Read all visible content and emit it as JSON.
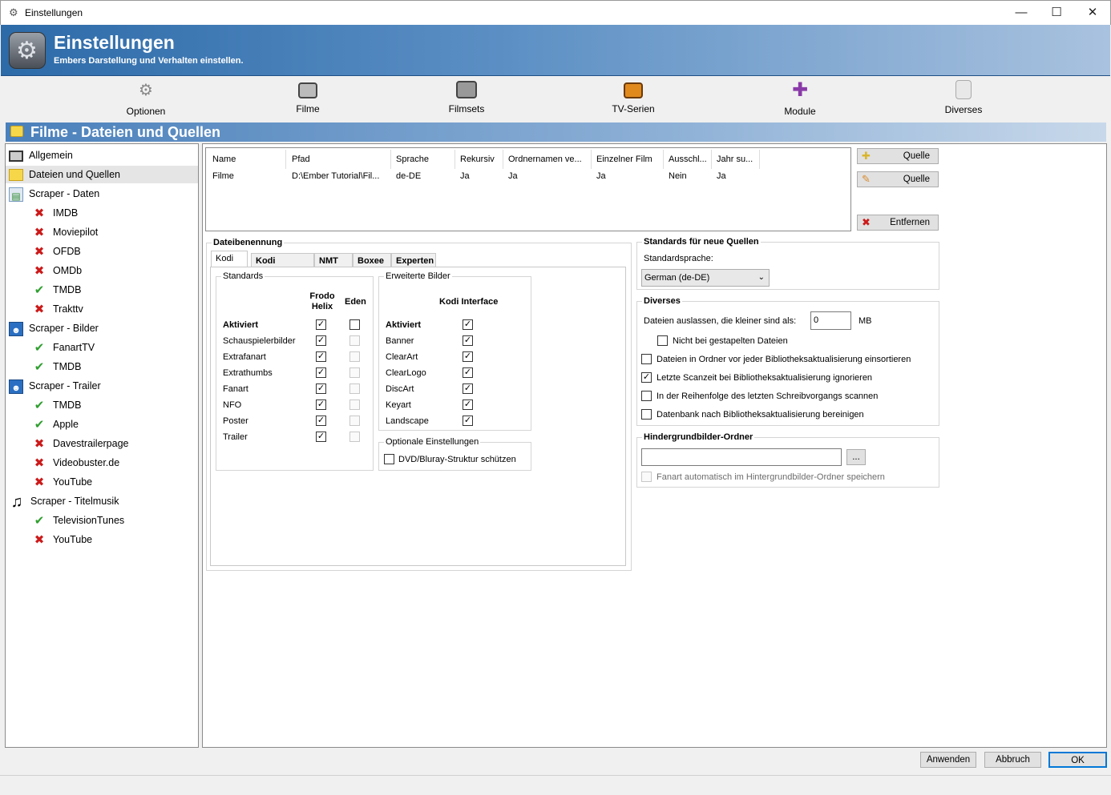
{
  "window": {
    "title": "Einstellungen",
    "minimize": "—",
    "maximize": "☐",
    "close": "✕"
  },
  "banner": {
    "title": "Einstellungen",
    "subtitle": "Embers Darstellung und Verhalten einstellen."
  },
  "toolbar": [
    {
      "label": "Optionen",
      "icon": "gear-icon"
    },
    {
      "label": "Filme",
      "icon": "film-icon"
    },
    {
      "label": "Filmsets",
      "icon": "filmsets-icon"
    },
    {
      "label": "TV-Serien",
      "icon": "tv-icon"
    },
    {
      "label": "Module",
      "icon": "puzzle-icon"
    },
    {
      "label": "Diverses",
      "icon": "document-icon"
    }
  ],
  "section_title": "Filme - Dateien und Quellen",
  "tree": [
    {
      "label": "Allgemein",
      "icon": "film-icon",
      "level": 0
    },
    {
      "label": "Dateien und Quellen",
      "icon": "folder-icon",
      "level": 0,
      "selected": true
    },
    {
      "label": "Scraper - Daten",
      "icon": "scraper-data-icon",
      "level": 0
    },
    {
      "label": "IMDB",
      "icon": "x-icon",
      "level": 1
    },
    {
      "label": "Moviepilot",
      "icon": "x-icon",
      "level": 1
    },
    {
      "label": "OFDB",
      "icon": "x-icon",
      "level": 1
    },
    {
      "label": "OMDb",
      "icon": "x-icon",
      "level": 1
    },
    {
      "label": "TMDB",
      "icon": "check-icon",
      "level": 1
    },
    {
      "label": "Trakttv",
      "icon": "x-icon",
      "level": 1
    },
    {
      "label": "Scraper - Bilder",
      "icon": "scraper-image-icon",
      "level": 0
    },
    {
      "label": "FanartTV",
      "icon": "check-icon",
      "level": 1
    },
    {
      "label": "TMDB",
      "icon": "check-icon",
      "level": 1
    },
    {
      "label": "Scraper - Trailer",
      "icon": "scraper-image-icon",
      "level": 0
    },
    {
      "label": "TMDB",
      "icon": "check-icon",
      "level": 1
    },
    {
      "label": "Apple",
      "icon": "check-icon",
      "level": 1
    },
    {
      "label": "Davestrailerpage",
      "icon": "x-icon",
      "level": 1
    },
    {
      "label": "Videobuster.de",
      "icon": "x-icon",
      "level": 1
    },
    {
      "label": "YouTube",
      "icon": "x-icon",
      "level": 1
    },
    {
      "label": "Scraper - Titelmusik",
      "icon": "music-icon",
      "level": 0
    },
    {
      "label": "TelevisionTunes",
      "icon": "check-icon",
      "level": 1
    },
    {
      "label": "YouTube",
      "icon": "x-icon",
      "level": 1
    }
  ],
  "sources": {
    "columns": [
      "Name",
      "Pfad",
      "Sprache",
      "Rekursiv",
      "Ordnernamen ve...",
      "Einzelner Film",
      "Ausschl...",
      "Jahr su..."
    ],
    "rows": [
      [
        "Filme",
        "D:\\Ember Tutorial\\Fil...",
        "de-DE",
        "Ja",
        "Ja",
        "Ja",
        "Nein",
        "Ja"
      ]
    ]
  },
  "buttons": {
    "add": "Quelle",
    "edit": "Quelle",
    "remove": "Entfernen",
    "apply": "Anwenden",
    "cancel": "Abbruch",
    "ok": "OK",
    "browse": "..."
  },
  "naming": {
    "group": "Dateibenennung",
    "tabs": [
      "Kodi",
      "Kodi Addons",
      "NMT",
      "Boxee",
      "Experten"
    ],
    "standards": {
      "group": "Standards",
      "col_frodo": "Frodo Helix",
      "col_eden": "Eden",
      "rows": [
        {
          "label": "Aktiviert",
          "bold": true,
          "frodo": true,
          "eden": false,
          "eden_enabled": true
        },
        {
          "label": "Schauspielerbilder",
          "frodo": true,
          "eden": false,
          "eden_enabled": false
        },
        {
          "label": "Extrafanart",
          "frodo": true,
          "eden": false,
          "eden_enabled": false
        },
        {
          "label": "Extrathumbs",
          "frodo": true,
          "eden": false,
          "eden_enabled": false
        },
        {
          "label": "Fanart",
          "frodo": true,
          "eden": false,
          "eden_enabled": false
        },
        {
          "label": "NFO",
          "frodo": true,
          "eden": false,
          "eden_enabled": false
        },
        {
          "label": "Poster",
          "frodo": true,
          "eden": false,
          "eden_enabled": false
        },
        {
          "label": "Trailer",
          "frodo": true,
          "eden": false,
          "eden_enabled": false
        }
      ]
    },
    "extended": {
      "group": "Erweiterte Bilder",
      "col": "Kodi Interface",
      "rows": [
        {
          "label": "Aktiviert",
          "bold": true,
          "checked": true
        },
        {
          "label": "Banner",
          "checked": true
        },
        {
          "label": "ClearArt",
          "checked": true
        },
        {
          "label": "ClearLogo",
          "checked": true
        },
        {
          "label": "DiscArt",
          "checked": true
        },
        {
          "label": "Keyart",
          "checked": true
        },
        {
          "label": "Landscape",
          "checked": true
        }
      ]
    },
    "optional": {
      "group": "Optionale Einstellungen",
      "label": "DVD/Bluray-Struktur schützen",
      "checked": false
    }
  },
  "defaults": {
    "group": "Standards für neue Quellen",
    "lang_label": "Standardsprache:",
    "lang_value": "German (de-DE)"
  },
  "diverses": {
    "group": "Diverses",
    "skip_label": "Dateien auslassen, die kleiner sind als:",
    "skip_value": "0",
    "skip_unit": "MB",
    "options": [
      {
        "label": "Nicht bei gestapelten Dateien",
        "checked": false
      },
      {
        "label": "Dateien in Ordner vor jeder Bibliotheksaktualisierung einsortieren",
        "checked": false
      },
      {
        "label": "Letzte Scanzeit bei Bibliotheksaktualisierung ignorieren",
        "checked": true
      },
      {
        "label": "In der Reihenfolge des letzten Schreibvorgangs scannen",
        "checked": false
      },
      {
        "label": "Datenbank nach Bibliotheksaktualisierung bereinigen",
        "checked": false
      }
    ]
  },
  "backdrop": {
    "group": "Hindergrundbilder-Ordner",
    "path": "",
    "auto_label": "Fanart automatisch im Hintergrundbilder-Ordner speichern",
    "checked": false
  }
}
